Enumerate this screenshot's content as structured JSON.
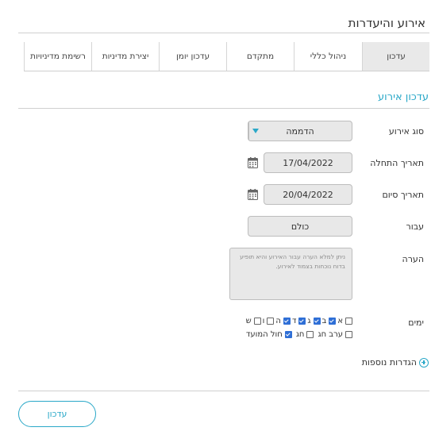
{
  "page": {
    "title": "אירוע והיעדרות"
  },
  "tabs": [
    {
      "label": "עדכון",
      "active": true
    },
    {
      "label": "ניהול כללי",
      "active": false
    },
    {
      "label": "מתקדם",
      "active": false
    },
    {
      "label": "עדכון יומן",
      "active": false
    },
    {
      "label": "יצירת מדיניות",
      "active": false
    },
    {
      "label": "רשימת מדיניויות",
      "active": false
    }
  ],
  "section": {
    "title": "עדכון אירוע"
  },
  "form": {
    "event_type": {
      "label": "סוג אירוע",
      "value": "הדממה"
    },
    "start_date": {
      "label": "תאריך התחלה",
      "value": "17/04/2022"
    },
    "end_date": {
      "label": "תאריך סיום",
      "value": "20/04/2022"
    },
    "for": {
      "label": "עבור",
      "value": "כולם"
    },
    "note": {
      "label": "הערה",
      "placeholder": "ניתן למלא הערה עבור האירוע והיא תופיע בדוח נוכחות בצמוד לאירוע."
    },
    "days": {
      "label": "ימים",
      "row1": [
        {
          "label": "א",
          "checked": false
        },
        {
          "label": "ב",
          "checked": true
        },
        {
          "label": "ג",
          "checked": true
        },
        {
          "label": "ד",
          "checked": true
        },
        {
          "label": "ה",
          "checked": true
        },
        {
          "label": "ו",
          "checked": false
        },
        {
          "label": "ש",
          "checked": false
        }
      ],
      "row2": [
        {
          "label": "ערב חג",
          "checked": false
        },
        {
          "label": "חג",
          "checked": false
        },
        {
          "label": "חול המועד",
          "checked": true
        }
      ]
    }
  },
  "more_settings": {
    "label": "הגדרות נוספות"
  },
  "actions": {
    "update_label": "עדכון"
  },
  "colors": {
    "accent": "#2aa8c8",
    "checkbox": "#2f6fd6",
    "field_bg": "#e8e8e8"
  }
}
